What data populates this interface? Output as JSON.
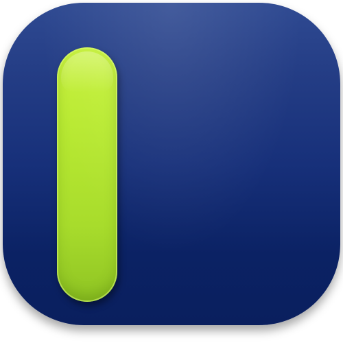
{
  "icon": {
    "name": "app-icon",
    "colors": {
      "background_top": "#2f4a92",
      "background_bottom": "#0a1f5e",
      "pill": "#b9ea32",
      "pill_bottom": "#8fc423"
    }
  }
}
